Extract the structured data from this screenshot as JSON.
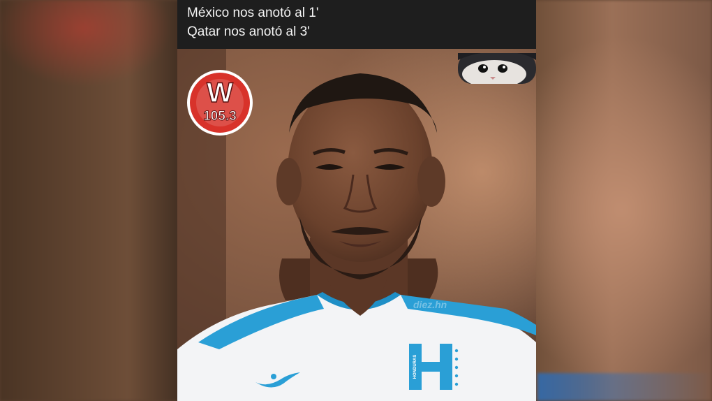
{
  "caption": {
    "line1": "México nos anotó al 1'",
    "line2": "Qatar nos anotó al 3'"
  },
  "overlays": {
    "radio_logo": {
      "letter": "W",
      "frequency": "105.3",
      "color": "#d8322a"
    },
    "watermark": "diez.hn",
    "crest_text": "HONDURAS",
    "jersey_colors": {
      "base": "#f3f4f6",
      "accent": "#2a9fd6"
    }
  },
  "icons": [
    "radio-w-logo-icon",
    "cat-peek-icon",
    "joma-logo-icon",
    "honduras-crest-icon"
  ]
}
